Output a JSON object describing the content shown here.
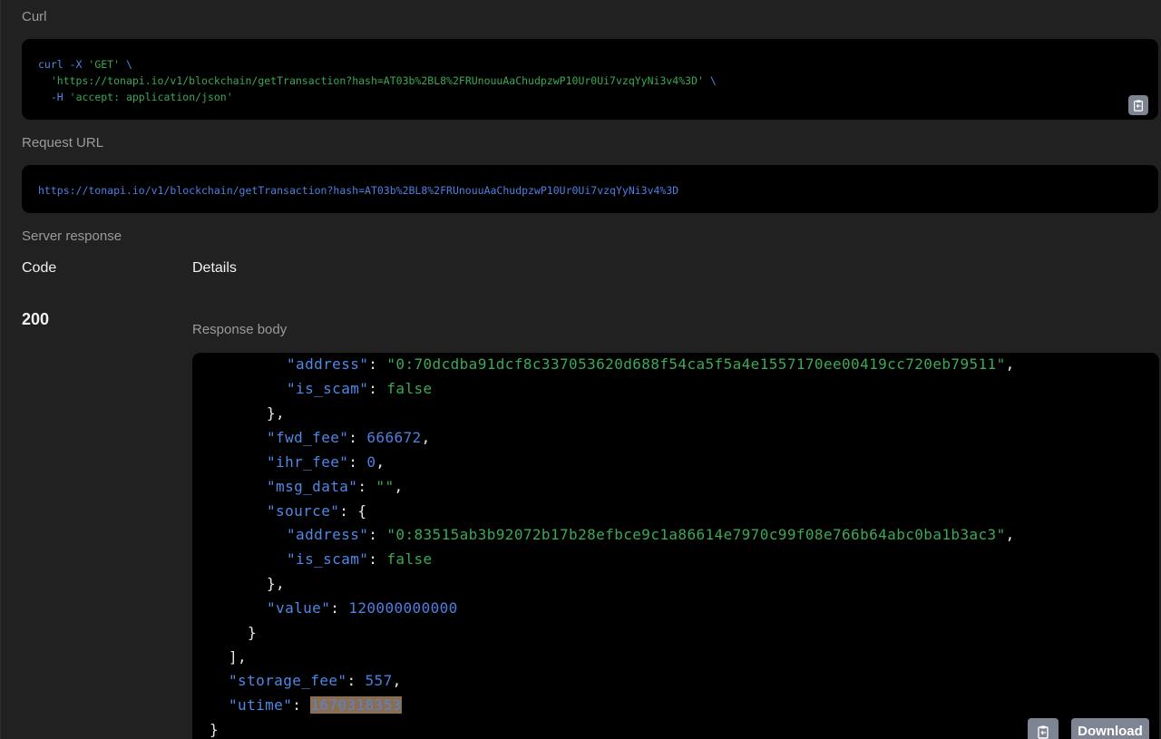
{
  "curl": {
    "label": "Curl",
    "line1_cmd": "curl -X ",
    "line1_method": "'GET'",
    "line1_tail": " \\",
    "line2_url": "'https://tonapi.io/v1/blockchain/getTransaction?hash=AT03b%2BL8%2FRUnouuAaChudpzwP10Ur0Ui7vzqYyNi3v4%3D'",
    "line2_tail": " \\",
    "line3_flag": "-H ",
    "line3_header": "'accept: application/json'"
  },
  "request_url": {
    "label": "Request URL",
    "value": "https://tonapi.io/v1/blockchain/getTransaction?hash=AT03b%2BL8%2FRUnouuAaChudpzwP10Ur0Ui7vzqYyNi3v4%3D"
  },
  "server_response": {
    "label": "Server response",
    "code_header": "Code",
    "details_header": "Details",
    "status_code": "200",
    "response_body_label": "Response body",
    "download_label": "Download"
  },
  "json": {
    "address_key": "\"address\"",
    "address1": "\"0:70dcdba91dcf8c337053620d688f54ca5f5a4e1557170ee00419cc720eb79511\"",
    "is_scam_key": "\"is_scam\"",
    "is_scam1": "false",
    "fwd_fee_key": "\"fwd_fee\"",
    "fwd_fee": "666672",
    "ihr_fee_key": "\"ihr_fee\"",
    "ihr_fee": "0",
    "msg_data_key": "\"msg_data\"",
    "msg_data": "\"\"",
    "source_key": "\"source\"",
    "address2": "\"0:83515ab3b92072b17b28efbce9c1a86614e7970c99f08e766b64abc0ba1b3ac3\"",
    "is_scam2": "false",
    "value_key": "\"value\"",
    "value": "120000000000",
    "storage_fee_key": "\"storage_fee\"",
    "storage_fee": "557",
    "utime_key": "\"utime\"",
    "utime": "1670318353"
  },
  "icons": {
    "copy": "clipboard-icon"
  }
}
